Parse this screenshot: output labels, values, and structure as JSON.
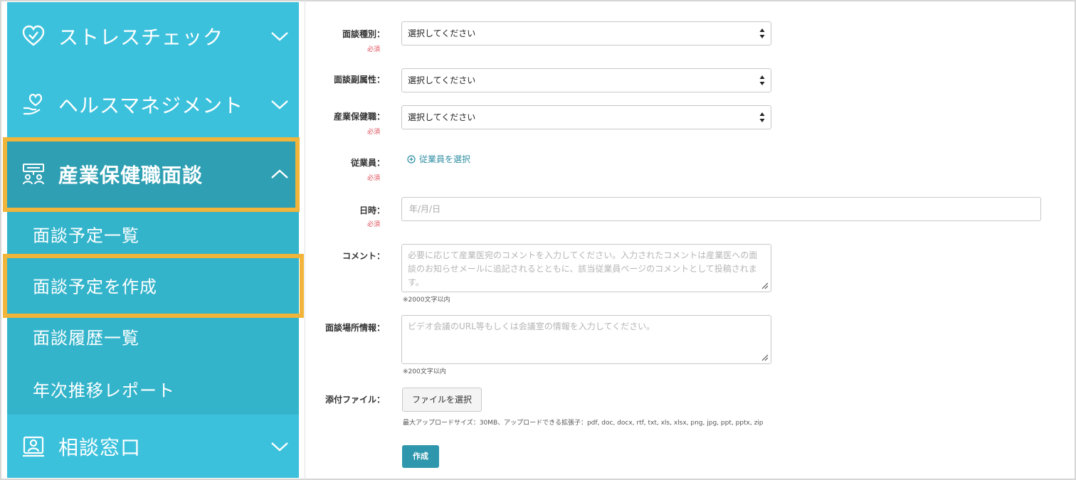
{
  "sidebar": {
    "nav": [
      {
        "label": "ストレスチェック",
        "icon": "heart-check-icon",
        "expanded": false
      },
      {
        "label": "ヘルスマネジメント",
        "icon": "hand-heart-icon",
        "expanded": false
      },
      {
        "label": "産業保健職面談",
        "icon": "meeting-icon",
        "expanded": true,
        "active": true
      },
      {
        "label": "相談窓口",
        "icon": "person-frame-icon",
        "expanded": false
      }
    ],
    "sub_items": [
      "面談予定一覧",
      "面談予定を作成",
      "面談履歴一覧",
      "年次推移レポート"
    ],
    "highlight_color": "#f0b53a",
    "bg_color": "#3cc1dc",
    "active_color": "#2f9fb3"
  },
  "form": {
    "type_label": "面談種別：",
    "sub_attr_label": "面談副属性：",
    "staff_label": "産業保健職：",
    "employee_label": "従業員：",
    "datetime_label": "日時：",
    "comment_label": "コメント：",
    "location_label": "面談場所情報：",
    "attachment_label": "添付ファイル：",
    "required": "必須",
    "select_placeholder": "選択してください",
    "add_employee": "従業員を選択",
    "date_placeholder": "年/月/日",
    "comment_placeholder": "必要に応じて産業医宛のコメントを入力してください。入力されたコメントは産業医への面談のお知らせメールに追記されるとともに、該当従業員ページのコメントとして投稿されます。",
    "comment_limit": "※2000文字以内",
    "location_placeholder": "ビデオ会議のURL等もしくは会議室の情報を入力してください。",
    "location_limit": "※200文字以内",
    "file_button": "ファイルを選択",
    "upload_note": "最大アップロードサイズ：30MB、アップロードできる拡張子：pdf, doc, docx, rtf, txt, xls, xlsx, png, jpg, ppt, pptx, zip",
    "submit": "作成",
    "submit_color": "#2f97ad"
  }
}
